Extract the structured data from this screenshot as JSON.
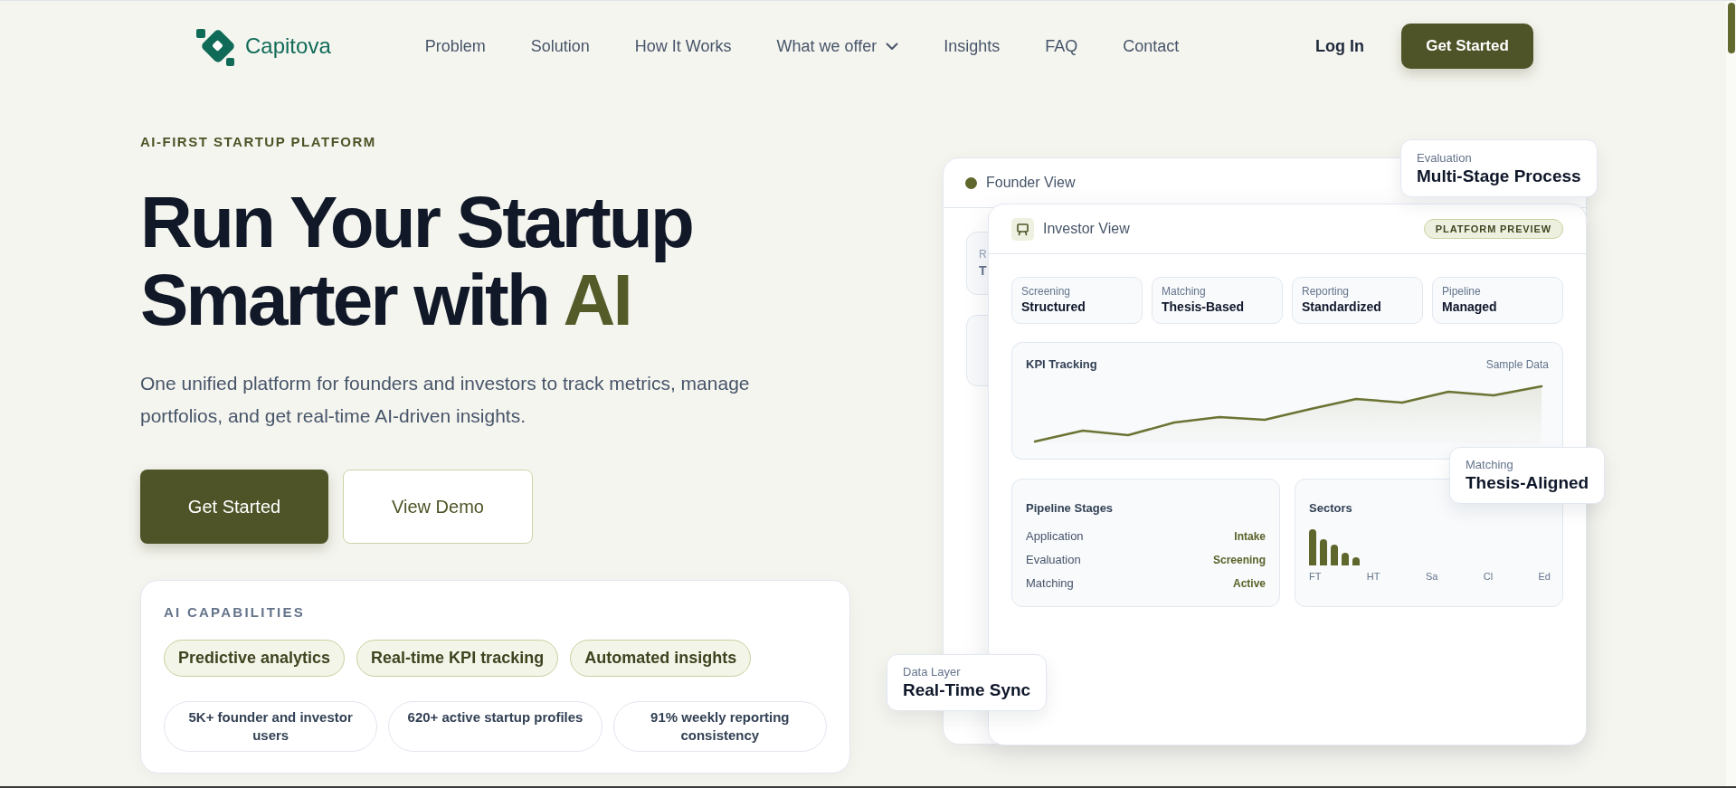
{
  "nav": {
    "brand": "Capitova",
    "links": [
      {
        "label": "Problem",
        "dropdown": false
      },
      {
        "label": "Solution",
        "dropdown": false
      },
      {
        "label": "How It Works",
        "dropdown": false
      },
      {
        "label": "What we offer",
        "dropdown": true
      },
      {
        "label": "Insights",
        "dropdown": false
      },
      {
        "label": "FAQ",
        "dropdown": false
      },
      {
        "label": "Contact",
        "dropdown": false
      }
    ],
    "login": "Log In",
    "cta": "Get Started"
  },
  "hero": {
    "eyebrow": "AI-FIRST STARTUP PLATFORM",
    "headline": [
      {
        "text": "Run Your Startup Smarter with",
        "highlight": false
      },
      {
        "text": "AI",
        "highlight": true
      }
    ],
    "description": "One unified platform for founders and investors to track metrics, manage portfolios, and get real-time AI-driven insights.",
    "buttons": [
      {
        "label": "Get Started",
        "kind": "primary"
      },
      {
        "label": "View Demo",
        "kind": "secondary"
      }
    ]
  },
  "capabilities": {
    "heading": "AI CAPABILITIES",
    "tags": [
      "Predictive analytics",
      "Real-time KPI tracking",
      "Automated insights"
    ],
    "stats": [
      "5K+ founder and investor users",
      "620+ active startup profiles",
      "91% weekly reporting consistency"
    ]
  },
  "preview": {
    "founder_view": {
      "title": "Founder View",
      "peek_cards": [
        {
          "label": "R",
          "value": "T"
        }
      ]
    },
    "investor_view": {
      "title": "Investor View",
      "badge": "PLATFORM PREVIEW",
      "metrics": [
        {
          "label": "Screening",
          "value": "Structured"
        },
        {
          "label": "Matching",
          "value": "Thesis-Based"
        },
        {
          "label": "Reporting",
          "value": "Standardized"
        },
        {
          "label": "Pipeline",
          "value": "Managed"
        }
      ],
      "kpi": {
        "title": "KPI Tracking",
        "note": "Sample Data"
      },
      "pipeline": {
        "title": "Pipeline Stages",
        "rows": [
          {
            "label": "Application",
            "value": "Intake"
          },
          {
            "label": "Evaluation",
            "value": "Screening"
          },
          {
            "label": "Matching",
            "value": "Active"
          }
        ]
      },
      "sectors": {
        "title": "Sectors",
        "labels": [
          "FT",
          "HT",
          "Sa",
          "Cl",
          "Ed"
        ]
      }
    },
    "floating_cards": [
      {
        "label": "Evaluation",
        "value": "Multi-Stage Process"
      },
      {
        "label": "Matching",
        "value": "Thesis-Aligned"
      },
      {
        "label": "Data Layer",
        "value": "Real-Time Sync"
      }
    ]
  }
}
